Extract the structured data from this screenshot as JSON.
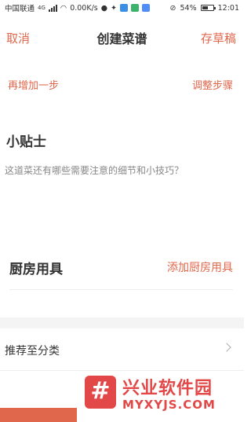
{
  "status_bar": {
    "carrier": "中国联通",
    "network": "4G",
    "speed": "0.00K/s",
    "battery": "54%",
    "battery_level": 0.54,
    "time": "12:01"
  },
  "nav": {
    "cancel_label": "取消",
    "title": "创建菜谱",
    "save_draft_label": "存草稿"
  },
  "steps": {
    "add_step_label": "再增加一步",
    "adjust_steps_label": "调整步骤"
  },
  "tips": {
    "title": "小贴士",
    "placeholder": "这道菜还有哪些需要注意的细节和小技巧？"
  },
  "tools": {
    "label": "厨房用具",
    "add_label": "添加厨房用具"
  },
  "category": {
    "label": "推荐至分类"
  },
  "watermark": {
    "logo_glyph": "#",
    "title": "兴业软件园",
    "url": "MYXYJS.COM"
  },
  "colors": {
    "accent": "#e0674b",
    "watermark": "#e24848",
    "text": "#333333",
    "placeholder": "#888888"
  }
}
